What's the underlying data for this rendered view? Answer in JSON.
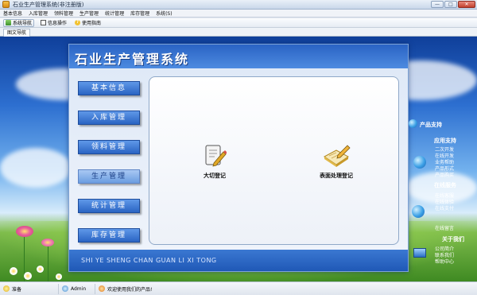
{
  "window": {
    "title": "石业生产管理系统(非注册版)",
    "controls": {
      "minimize": "—",
      "maximize": "□",
      "close": "✕"
    }
  },
  "menu": [
    "基本信息",
    "入库管理",
    "领料管理",
    "生产管理",
    "统计管理",
    "库存管理",
    "系统(S)"
  ],
  "toolbar": [
    {
      "label": "系统导航",
      "icon": "nav-icon",
      "active": true
    },
    {
      "label": "信息操作",
      "icon": "info-icon",
      "active": false
    },
    {
      "label": "使用指南",
      "icon": "help-icon",
      "active": false
    }
  ],
  "tabs": [
    "图文导航"
  ],
  "panel": {
    "title": "石业生产管理系统",
    "footer": "SHI YE SHENG CHAN GUAN LI XI TONG",
    "nav_buttons": [
      {
        "label": "基本信息",
        "selected": false
      },
      {
        "label": "入库管理",
        "selected": false
      },
      {
        "label": "领料管理",
        "selected": false
      },
      {
        "label": "生产管理",
        "selected": true
      },
      {
        "label": "统计管理",
        "selected": false
      },
      {
        "label": "库存管理",
        "selected": false
      }
    ],
    "functions": [
      {
        "label": "大切登记",
        "icon": "document-pencil-icon"
      },
      {
        "label": "表面处理登记",
        "icon": "notebook-pencil-icon"
      }
    ]
  },
  "support": {
    "heading": "产品支持",
    "app_support": {
      "title": "应用支持",
      "items": [
        "二次开发",
        "在线开发",
        "业务帮助",
        "产品形式",
        "产品购买"
      ]
    },
    "online": {
      "title": "在线服务",
      "items": [
        "在线客服",
        "在线体验",
        "在线支付",
        "在线留言"
      ]
    },
    "about": {
      "title": "关于我们",
      "items": [
        "公司简介",
        "联系我们",
        "帮助中心"
      ]
    }
  },
  "status": [
    {
      "text": "准备",
      "icon": "ready-icon"
    },
    {
      "text": "Admin",
      "icon": "user-icon"
    },
    {
      "text": "欢迎使用我们的产品!",
      "icon": "welcome-icon"
    }
  ],
  "colors": {
    "accent": "#2a63c4",
    "panel_header": "#3b78d2",
    "selected_button": "#a9c8f3"
  }
}
